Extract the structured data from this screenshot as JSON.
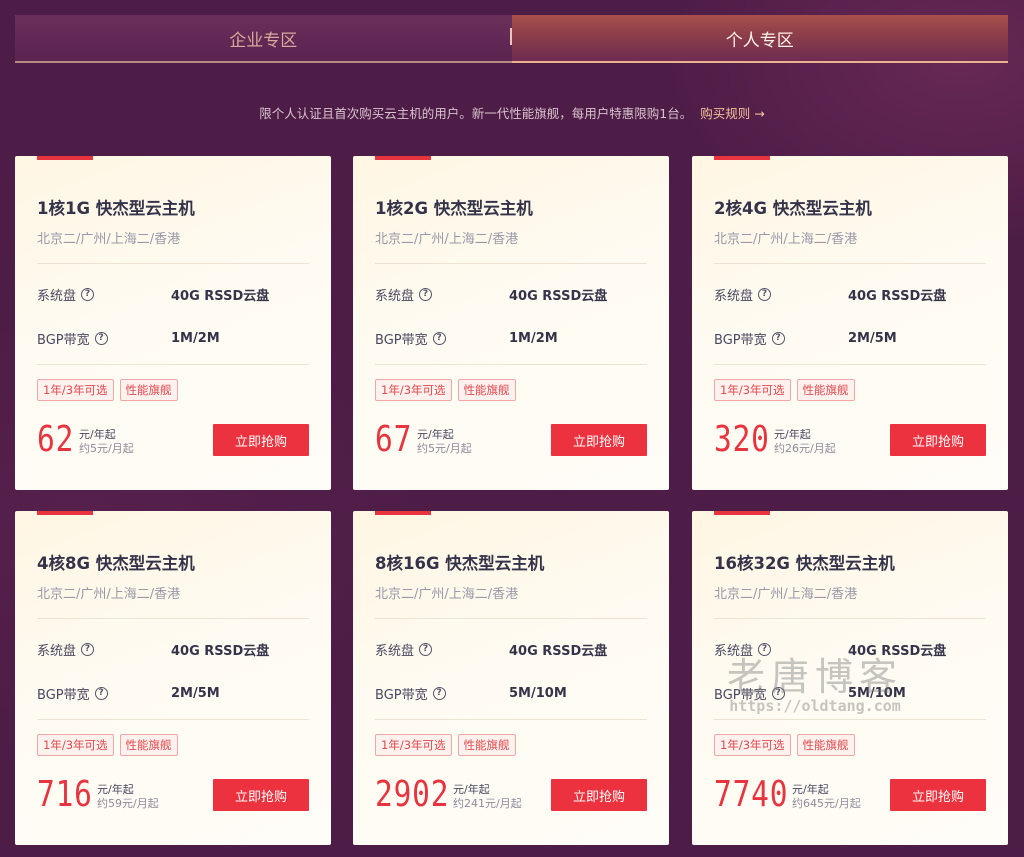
{
  "tabs": [
    {
      "label": "企业专区",
      "active": false
    },
    {
      "label": "个人专区",
      "active": true
    }
  ],
  "notice": {
    "text": "限个人认证且首次购买云主机的用户。新一代性能旗舰，每用户特惠限购1台。",
    "link_label": "购买规则 →"
  },
  "spec_labels": {
    "disk": "系统盘",
    "bandwidth": "BGP带宽"
  },
  "tags": [
    "1年/3年可选",
    "性能旗舰"
  ],
  "buy_label": "立即抢购",
  "colors": {
    "accent": "#ec323e",
    "background": "#4e1d47",
    "title": "#35334a"
  },
  "cards": [
    {
      "title": "1核1G 快杰型云主机",
      "regions": "北京二/广州/上海二/香港",
      "disk": "40G RSSD云盘",
      "bandwidth": "1M/2M",
      "price": "62",
      "unit": "元/年起",
      "monthly": "约5元/月起"
    },
    {
      "title": "1核2G 快杰型云主机",
      "regions": "北京二/广州/上海二/香港",
      "disk": "40G RSSD云盘",
      "bandwidth": "1M/2M",
      "price": "67",
      "unit": "元/年起",
      "monthly": "约5元/月起"
    },
    {
      "title": "2核4G 快杰型云主机",
      "regions": "北京二/广州/上海二/香港",
      "disk": "40G RSSD云盘",
      "bandwidth": "2M/5M",
      "price": "320",
      "unit": "元/年起",
      "monthly": "约26元/月起"
    },
    {
      "title": "4核8G 快杰型云主机",
      "regions": "北京二/广州/上海二/香港",
      "disk": "40G RSSD云盘",
      "bandwidth": "2M/5M",
      "price": "716",
      "unit": "元/年起",
      "monthly": "约59元/月起"
    },
    {
      "title": "8核16G 快杰型云主机",
      "regions": "北京二/广州/上海二/香港",
      "disk": "40G RSSD云盘",
      "bandwidth": "5M/10M",
      "price": "2902",
      "unit": "元/年起",
      "monthly": "约241元/月起"
    },
    {
      "title": "16核32G 快杰型云主机",
      "regions": "北京二/广州/上海二/香港",
      "disk": "40G RSSD云盘",
      "bandwidth": "5M/10M",
      "price": "7740",
      "unit": "元/年起",
      "monthly": "约645元/月起"
    }
  ],
  "watermark": {
    "title": "老唐博客",
    "url": "https://oldtang.com"
  }
}
